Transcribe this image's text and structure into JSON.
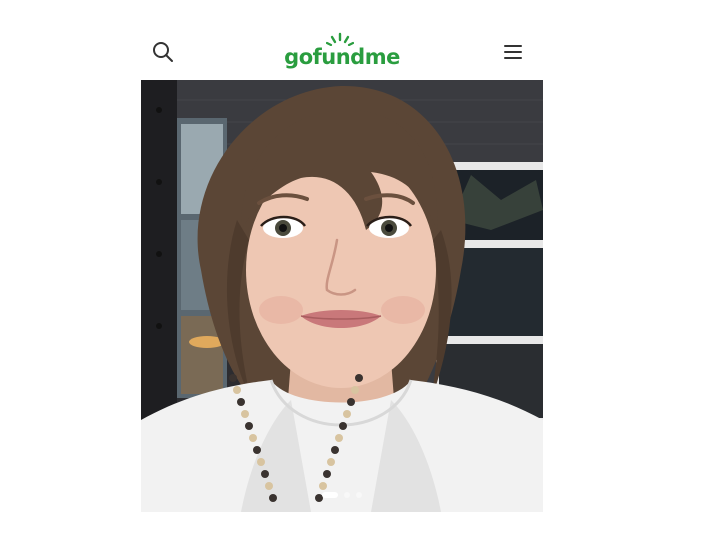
{
  "header": {
    "brand_text": "gofundme",
    "search_icon": "search-icon",
    "menu_icon": "hamburger-menu-icon"
  },
  "hero": {
    "image_subject": "selfie-photo",
    "slide_count": 3,
    "active_slide": 1
  },
  "colors": {
    "brand_green": "#2a9d3f",
    "icon_gray": "#333333"
  }
}
